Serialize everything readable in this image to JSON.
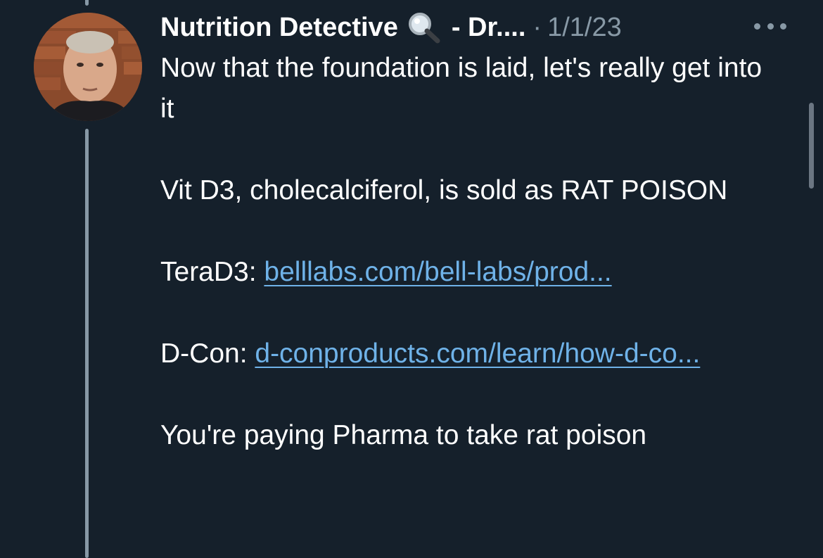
{
  "post": {
    "author_name": "Nutrition Detective",
    "author_icon": "magnifying-glass-icon",
    "author_tail": "- Dr....",
    "separator": "·",
    "timestamp": "1/1/23",
    "paragraphs": {
      "intro": "Now that the foundation is laid, let's really get into it",
      "vitd": "Vit D3, cholecalciferol, is sold as RAT POISON",
      "terad3_prefix": "TeraD3: ",
      "terad3_link": "belllabs.com/bell-labs/prod...",
      "dcon_prefix": "D-Con: ",
      "dcon_link": "d-conproducts.com/learn/how-d-co...",
      "closing": "You're paying Pharma to take rat poison"
    }
  },
  "icons": {
    "more": "more-options-icon",
    "avatar": "avatar"
  },
  "colors": {
    "background": "#15202b",
    "text": "#ffffff",
    "secondary": "#8899a6",
    "link": "#6fb2e8"
  }
}
